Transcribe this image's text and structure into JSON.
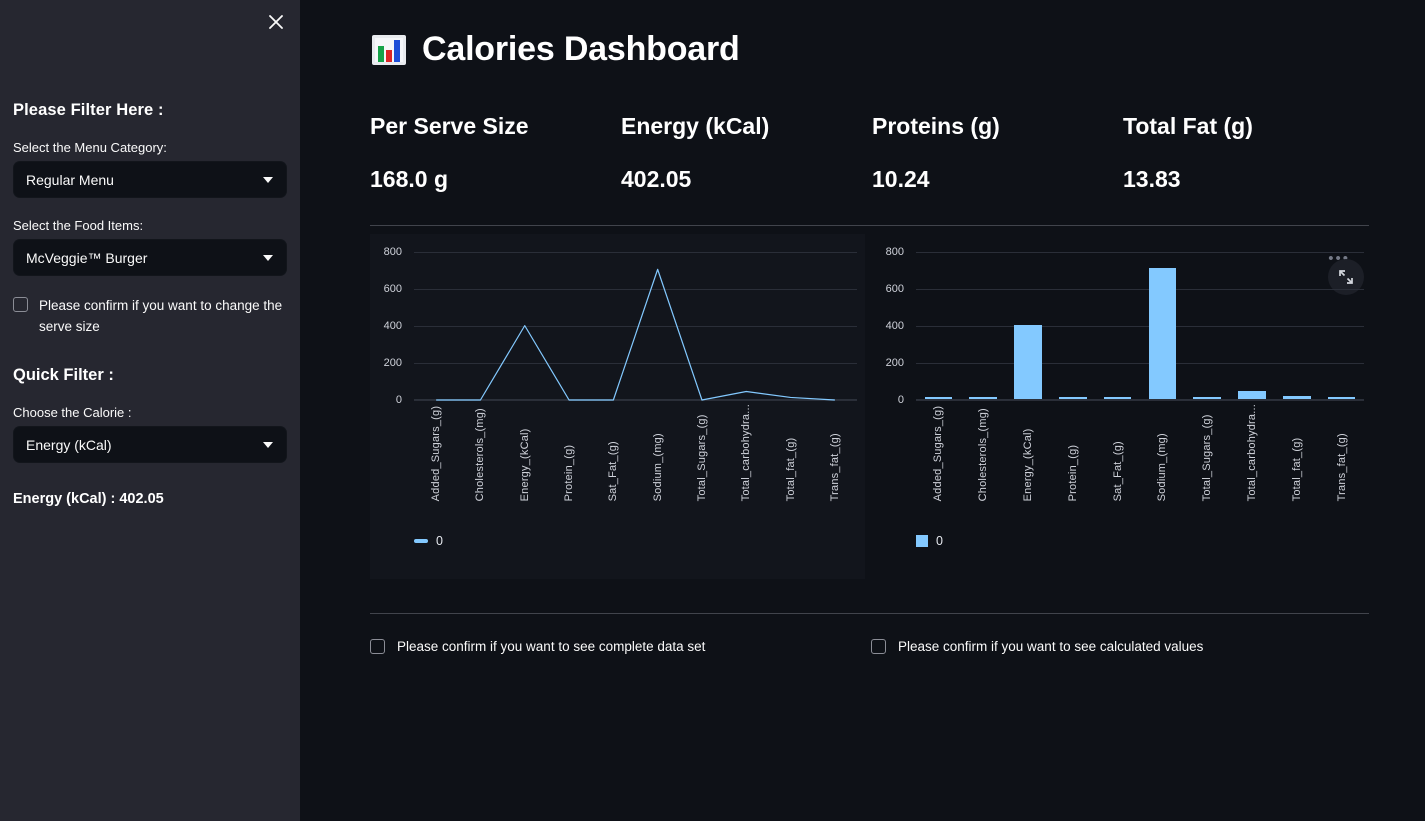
{
  "sidebar": {
    "close_icon": "close-icon",
    "filter_heading": "Please Filter Here :",
    "menu_category_label": "Select the Menu Category:",
    "menu_category_value": "Regular Menu",
    "food_items_label": "Select the Food Items:",
    "food_items_value": "McVeggie™ Burger",
    "serve_size_checkbox": "Please confirm if you want to change the serve size",
    "quick_filter_heading": "Quick Filter :",
    "calorie_label": "Choose the Calorie :",
    "calorie_value": "Energy (kCal)",
    "calorie_result": "Energy (kCal) : 402.05"
  },
  "header": {
    "icon": "bar-chart-emoji",
    "title": "Calories Dashboard"
  },
  "metrics": [
    {
      "label": "Per Serve Size",
      "value": "168.0 g"
    },
    {
      "label": "Energy (kCal)",
      "value": "402.05"
    },
    {
      "label": "Proteins (g)",
      "value": "10.24"
    },
    {
      "label": "Total Fat (g)",
      "value": "13.83"
    }
  ],
  "toolbar": {
    "more_options": "•••",
    "fullscreen_icon": "fullscreen-icon"
  },
  "bottom_checks": [
    "Please confirm if you want to see complete data set",
    "Please confirm if you want to see calculated values"
  ],
  "colors": {
    "accent": "#83c9ff",
    "sidebar_bg": "#262730",
    "main_bg": "#0e1117",
    "divider": "#41444c",
    "text": "#fafafa"
  },
  "chart_data": [
    {
      "type": "line",
      "title": "",
      "xlabel": "",
      "ylabel": "",
      "grid": true,
      "legend_position": "bottom-left",
      "ylim": [
        0,
        800
      ],
      "yticks": [
        0,
        200,
        400,
        600,
        800
      ],
      "categories": [
        "Added_Sugars_(g)",
        "Cholesterols_(mg)",
        "Energy_(kCal)",
        "Protein_(g)",
        "Sat_Fat_(g)",
        "Sodium_(mg)",
        "Total_Sugars_(g)",
        "Total_carbohydra...",
        "Total_fat_(g)",
        "Trans_fat_(g)"
      ],
      "series": [
        {
          "name": "0",
          "values": [
            0,
            0,
            402.05,
            0,
            0,
            706.13,
            0,
            45.82,
            13.83,
            0
          ]
        }
      ]
    },
    {
      "type": "bar",
      "title": "",
      "xlabel": "",
      "ylabel": "",
      "grid": true,
      "legend_position": "bottom-left",
      "ylim": [
        0,
        800
      ],
      "yticks": [
        0,
        200,
        400,
        600,
        800
      ],
      "categories": [
        "Added_Sugars_(g)",
        "Cholesterols_(mg)",
        "Energy_(kCal)",
        "Protein_(g)",
        "Sat_Fat_(g)",
        "Sodium_(mg)",
        "Total_Sugars_(g)",
        "Total_carbohydra...",
        "Total_fat_(g)",
        "Trans_fat_(g)"
      ],
      "series": [
        {
          "name": "0",
          "values": [
            0,
            0,
            402.05,
            5.5,
            0,
            706.13,
            0,
            45.82,
            13.83,
            0
          ]
        }
      ]
    }
  ]
}
